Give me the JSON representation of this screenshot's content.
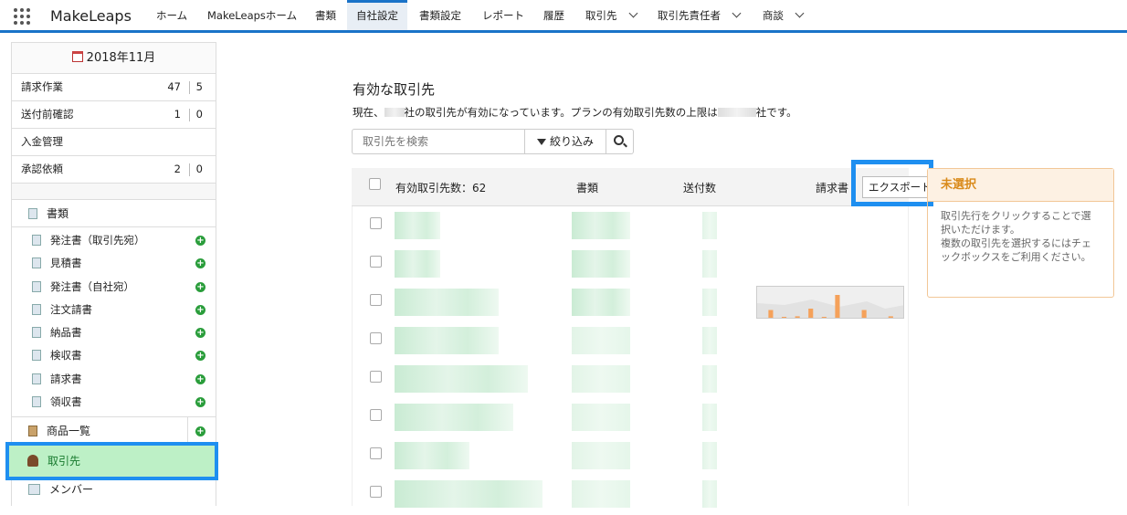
{
  "app": {
    "name": "MakeLeaps"
  },
  "nav": {
    "items": [
      {
        "label": "ホーム"
      },
      {
        "label": "MakeLeapsホーム"
      },
      {
        "label": "書類"
      },
      {
        "label": "自社設定"
      },
      {
        "label": "書類設定"
      },
      {
        "label": "レポート"
      },
      {
        "label": "履歴"
      },
      {
        "label": "取引先"
      },
      {
        "label": "取引先責任者"
      },
      {
        "label": "商談"
      }
    ],
    "active": "自社設定"
  },
  "sidebar": {
    "month": "2018年11月",
    "counters": [
      {
        "label": "請求作業",
        "a": "47",
        "b": "5"
      },
      {
        "label": "送付前確認",
        "a": "1",
        "b": "0"
      },
      {
        "label": "入金管理",
        "a": "",
        "b": ""
      },
      {
        "label": "承認依頼",
        "a": "2",
        "b": "0"
      }
    ],
    "documents_label": "書類",
    "document_types": [
      "発注書（取引先宛）",
      "見積書",
      "発注書（自社宛）",
      "注文請書",
      "納品書",
      "検収書",
      "請求書",
      "領収書"
    ],
    "products_label": "商品一覧",
    "clients_label": "取引先",
    "members_label": "メンバー"
  },
  "main": {
    "title": "有効な取引先",
    "desc_prefix": "現在、",
    "desc_mid": "社の取引先が有効になっています。プランの有効取引先数の上限は",
    "desc_suffix": "社です。",
    "search_placeholder": "取引先を検索",
    "filter_label": "絞り込み",
    "table": {
      "count_label": "有効取引先数：62",
      "col_documents": "書類",
      "col_sent": "送付数",
      "col_invoice": "請求書",
      "export_label": "エクスポート"
    }
  },
  "side_panel": {
    "title": "未選択",
    "body_line1": "取引先行をクリックすることで選択いただけます。",
    "body_line2": "複数の取引先を選択するにはチェックボックスをご利用ください。"
  },
  "chart_data": {
    "type": "bar",
    "series": [
      {
        "values": [
          0.35,
          0.1,
          0.12,
          0.4,
          0.1,
          0.9,
          0.05,
          0.35,
          0.02,
          0.12
        ]
      }
    ]
  },
  "colors": {
    "accent": "#1a73c8",
    "highlight": "#1e8ff0",
    "selected_bg": "#bdf0c6",
    "panel_title": "#d98a1a",
    "bar": "#f5a15a"
  }
}
